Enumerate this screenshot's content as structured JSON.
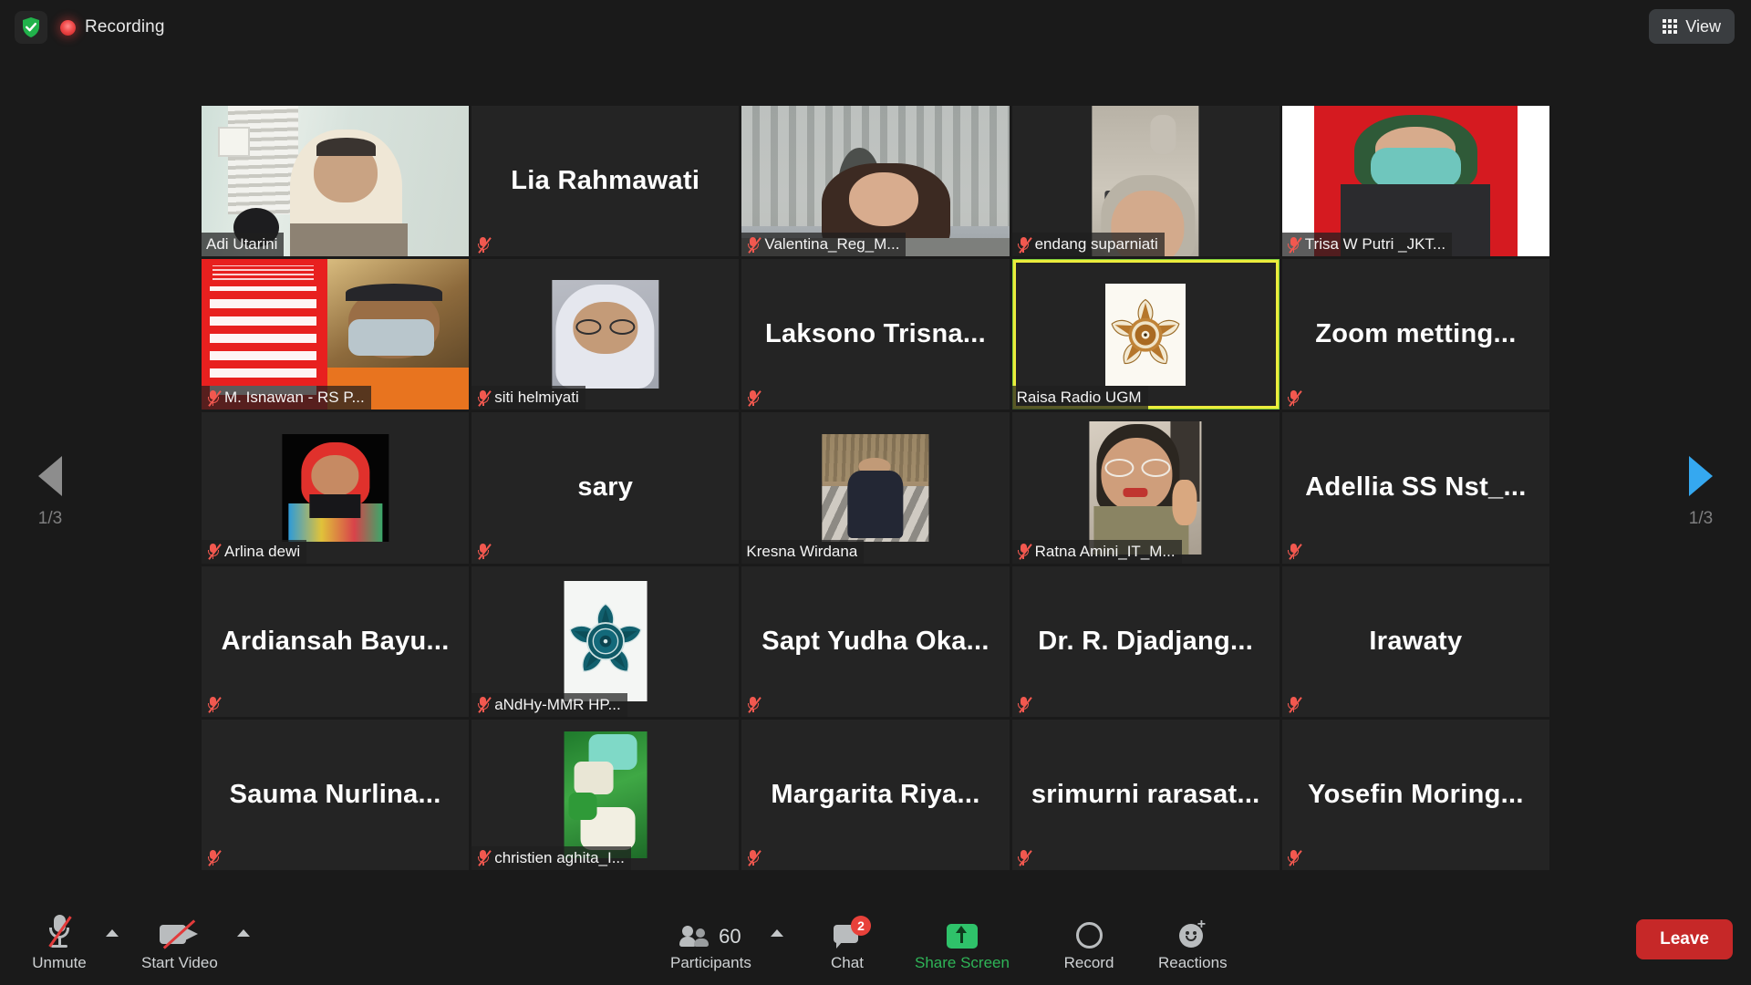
{
  "topbar": {
    "shield_icon": "shield-check-icon",
    "recording_icon": "recording-dot-icon",
    "recording_label": "Recording",
    "view_label": "View",
    "view_icon": "grid-view-icon"
  },
  "pager": {
    "prev_icon": "chevron-left-triangle-icon",
    "next_icon": "chevron-right-triangle-icon",
    "left_page": "1/3",
    "right_page": "1/3",
    "prev_color": "#8d8d8d",
    "next_color": "#35a8f0"
  },
  "gallery": {
    "columns": 5,
    "rows": 5,
    "active_border_color": "#ecec3c",
    "mute_icon_color": "#f2584f",
    "tiles": [
      {
        "name": "Adi Utarini",
        "muted": false,
        "display": "video",
        "media": "woman-hijab-stairs",
        "label_style": "overlay"
      },
      {
        "name": "Lia Rahmawati",
        "muted": true,
        "display": "name"
      },
      {
        "name": "Valentina_Reg_M...",
        "muted": true,
        "display": "video",
        "media": "woman-cathedral-ruins",
        "label_style": "overlay"
      },
      {
        "name": "endang suparniati",
        "muted": true,
        "display": "video",
        "media": "elderly-woman-closeup",
        "label_style": "overlay"
      },
      {
        "name": "Trisa W Putri _JKT...",
        "muted": true,
        "display": "video",
        "media": "woman-mask-red-backdrop",
        "label_style": "overlay"
      },
      {
        "name": "M. Isnawan - RS P...",
        "muted": true,
        "display": "video",
        "media": "covid-poster-masked-man",
        "label_style": "overlay"
      },
      {
        "name": "siti helmiyati",
        "muted": true,
        "display": "photo",
        "media": "woman-glasses-white-hijab",
        "label_style": "overlay"
      },
      {
        "name": "Laksono  Trisna...",
        "muted": true,
        "display": "name"
      },
      {
        "name": "Raisa Radio UGM",
        "muted": false,
        "display": "photo",
        "media": "ugm-gold-emblem",
        "label_style": "overlay",
        "active": true
      },
      {
        "name": "Zoom  metting...",
        "muted": true,
        "display": "name"
      },
      {
        "name": "Arlina dewi",
        "muted": true,
        "display": "photo",
        "media": "woman-red-hijab-portrait",
        "label_style": "overlay"
      },
      {
        "name": "sary",
        "muted": true,
        "display": "name"
      },
      {
        "name": "Kresna Wirdana",
        "muted": false,
        "display": "photo",
        "media": "man-outdoors-rocks",
        "label_style": "overlay"
      },
      {
        "name": "Ratna Amini_IT_M...",
        "muted": true,
        "display": "video",
        "media": "woman-glasses-peace-sign",
        "label_style": "overlay"
      },
      {
        "name": "Adellia SS Nst_...",
        "muted": true,
        "display": "name"
      },
      {
        "name": "Ardiansah  Bayu...",
        "muted": true,
        "display": "name"
      },
      {
        "name": "aNdHy-MMR HP...",
        "muted": true,
        "display": "photo",
        "media": "ugm-teal-emblem",
        "label_style": "overlay"
      },
      {
        "name": "Sapt Yudha Oka...",
        "muted": true,
        "display": "name"
      },
      {
        "name": "Dr. R. Djadjang...",
        "muted": true,
        "display": "name"
      },
      {
        "name": "Irawaty",
        "muted": true,
        "display": "name"
      },
      {
        "name": "Sauma  Nurlina...",
        "muted": true,
        "display": "name"
      },
      {
        "name": "christien aghita_I...",
        "muted": true,
        "display": "photo",
        "media": "surgery-green-drape",
        "label_style": "overlay"
      },
      {
        "name": "Margarita  Riya...",
        "muted": true,
        "display": "name"
      },
      {
        "name": "srimurni  rarasat...",
        "muted": true,
        "display": "name"
      },
      {
        "name": "Yosefin  Moring...",
        "muted": true,
        "display": "name"
      }
    ]
  },
  "toolbar": {
    "mute": {
      "label": "Unmute",
      "icon": "microphone-muted-icon",
      "has_chevron": true
    },
    "video": {
      "label": "Start Video",
      "icon": "camera-off-icon",
      "has_chevron": true
    },
    "participants": {
      "label": "Participants",
      "icon": "participants-icon",
      "count": "60",
      "has_chevron": true
    },
    "chat": {
      "label": "Chat",
      "icon": "chat-bubble-icon",
      "badge": "2",
      "badge_color": "#e8413a"
    },
    "share": {
      "label": "Share Screen",
      "icon": "share-screen-up-arrow-icon",
      "color": "#2fb457"
    },
    "record": {
      "label": "Record",
      "icon": "record-circle-icon"
    },
    "reactions": {
      "label": "Reactions",
      "icon": "reactions-smiley-plus-icon"
    },
    "leave": {
      "label": "Leave",
      "color": "#c62828"
    }
  }
}
